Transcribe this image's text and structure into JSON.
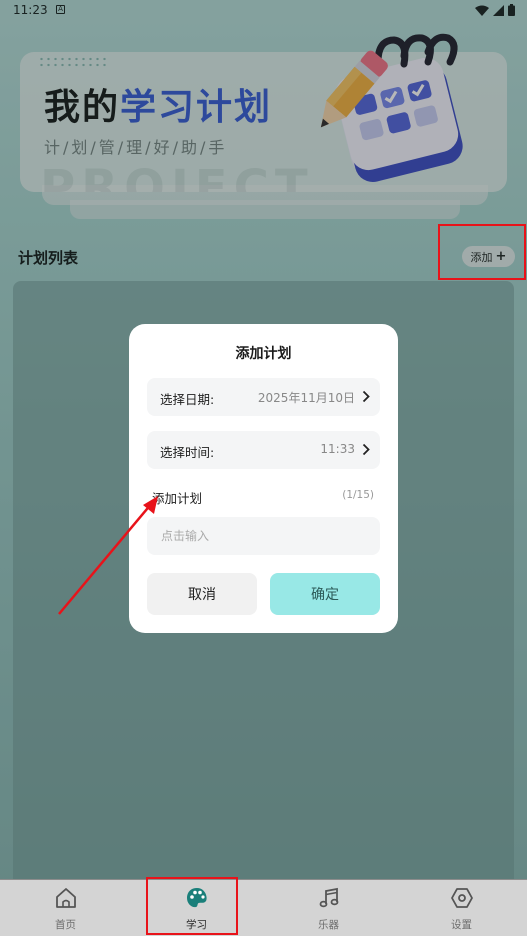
{
  "status_bar": {
    "time": "11:23",
    "notification_glyph": "A"
  },
  "banner": {
    "title_plain": "我的",
    "title_accent": "学习计划",
    "subtitle": "计/划/管/理/好/助/手",
    "watermark": "PROJECT",
    "accent_color": "#3f66d8",
    "art_icon": "calendar-pencil-icon"
  },
  "plan_list": {
    "title": "计划列表",
    "add_label": "添加",
    "add_icon": "plus-icon"
  },
  "dialog": {
    "title": "添加计划",
    "date_label": "选择日期:",
    "date_value": "2025年11月10日",
    "time_label": "选择时间:",
    "time_value": "11:33",
    "plan_label": "添加计划",
    "plan_count": "(1/15)",
    "plan_placeholder": "点击输入",
    "cancel_label": "取消",
    "confirm_label": "确定",
    "confirm_color": "#98e8e6"
  },
  "bottom_nav": {
    "items": [
      {
        "label": "首页",
        "icon": "home-icon"
      },
      {
        "label": "学习",
        "icon": "palette-icon",
        "active": true
      },
      {
        "label": "乐器",
        "icon": "music-note-icon"
      },
      {
        "label": "设置",
        "icon": "settings-hexagon-icon"
      }
    ]
  },
  "annotation": {
    "highlight_color": "#e8131a"
  }
}
